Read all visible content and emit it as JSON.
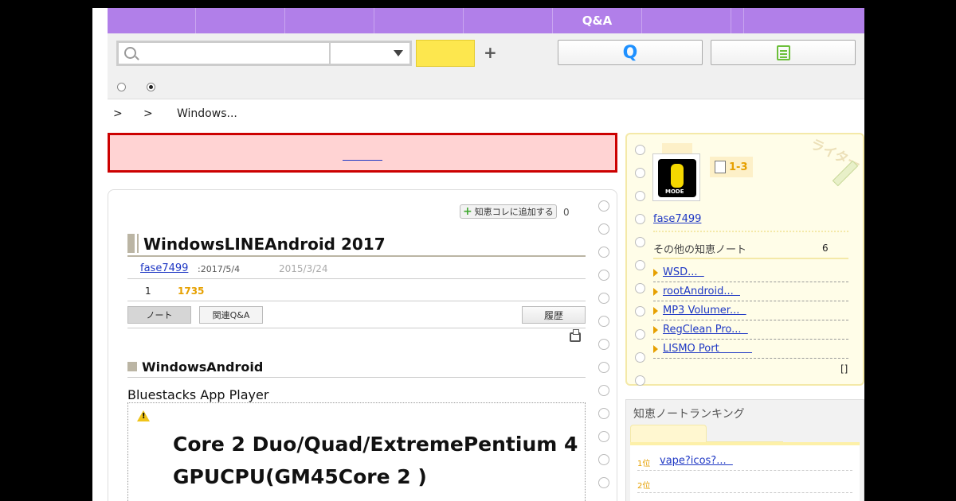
{
  "nav": {
    "tabs": [
      "",
      "",
      "",
      "",
      "",
      "Q&A",
      "",
      "",
      ""
    ]
  },
  "search": {
    "placeholder": "",
    "category": "",
    "plus": "+"
  },
  "breadcrumb": {
    "sep1": ">",
    "sep2": ">",
    "current": "Windows..."
  },
  "article": {
    "add_chie_label": "知恵コレに追加する",
    "add_count": "0",
    "title": "WindowsLINEAndroid 2017",
    "author": "fase7499",
    "updated": ":2017/5/4",
    "created": "2015/3/24",
    "count_a": "1",
    "views": "1735",
    "tab_note": "ノート",
    "tab_related": "関連Q&A",
    "tab_history": "履歴",
    "section_heading": "WindowsAndroid",
    "body_text": "Bluestacks App Player",
    "warning_line1": "Core 2 Duo/Quad/ExtremePentium 4",
    "warning_line2": "GPUCPU(GM45Core 2 )"
  },
  "profile": {
    "avatar_text": "MODE",
    "level": "1-3",
    "author": "fase7499",
    "other_notes_label": "その他の知恵ノート",
    "other_notes_count": "6",
    "notes": [
      "WSD...  ",
      "rootAndroid...  ",
      "MP3 Volumer...  ",
      "RegClean Pro...  ",
      "LISMO Port          "
    ],
    "more": "[]",
    "deco_text": "ライター"
  },
  "ranking": {
    "title": "知恵ノートランキング",
    "rows": [
      {
        "pos": "1位",
        "link": "vape?icos?...  "
      },
      {
        "pos": "2位",
        "link": ""
      }
    ]
  },
  "colors": {
    "nav": "#b17fe9",
    "search_button": "#fde74e",
    "alert_bg": "#ffd3d3",
    "alert_border": "#cc0000",
    "link": "#1f38c4",
    "accent": "#e6a000"
  }
}
